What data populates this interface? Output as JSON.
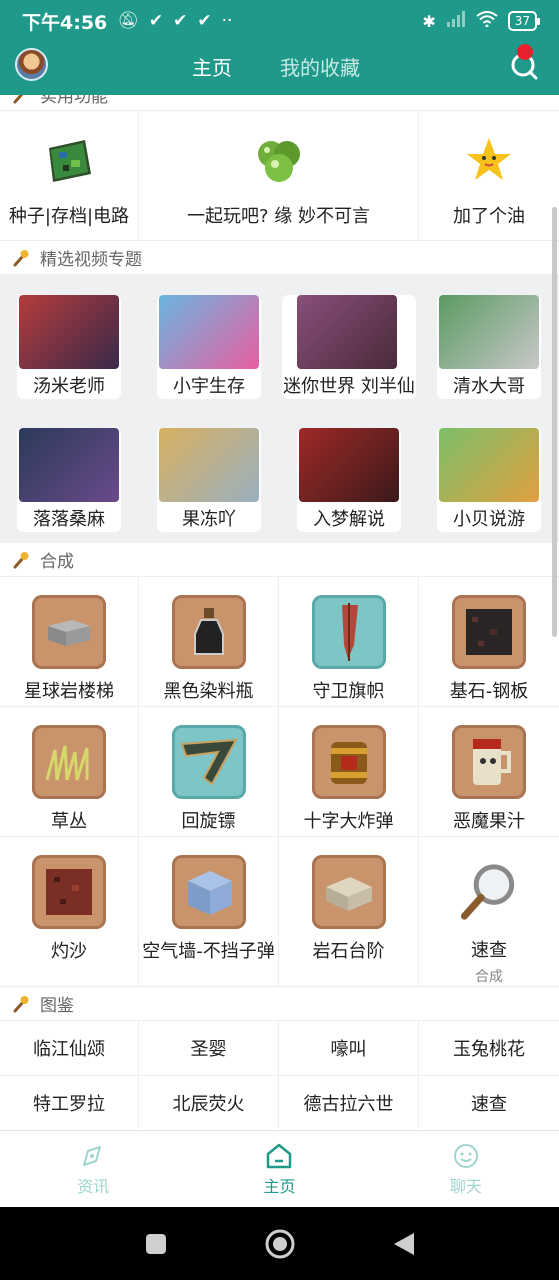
{
  "status": {
    "time": "下午4:56",
    "battery": "37"
  },
  "header": {
    "tabs": [
      {
        "label": "主页"
      },
      {
        "label": "我的收藏"
      }
    ]
  },
  "sections": {
    "utilities": {
      "title": "实用功能",
      "items": [
        {
          "label": "种子|存档|电路",
          "icon": "map-block-icon"
        },
        {
          "label": "一起玩吧? 缘 妙不可言",
          "icon": "green-orbs-icon"
        },
        {
          "label": "加了个油",
          "icon": "star-mascot-icon"
        }
      ]
    },
    "videos": {
      "title": "精选视频专题",
      "items": [
        {
          "label": "汤米老师",
          "color": "#b43b3b"
        },
        {
          "label": "小宇生存",
          "color": "#6ab6e0"
        },
        {
          "label": "迷你世界 刘半仙",
          "color": "#8a4f7a"
        },
        {
          "label": "清水大哥",
          "color": "#5a9a62"
        },
        {
          "label": "落落桑麻",
          "color": "#2b3a5a"
        },
        {
          "label": "果冻吖",
          "color": "#d8b060"
        },
        {
          "label": "入梦解说",
          "color": "#a02828"
        },
        {
          "label": "小贝说游",
          "color": "#7cbf6a"
        }
      ]
    },
    "crafting": {
      "title": "合成",
      "items": [
        {
          "label": "星球岩楼梯",
          "icon": "gray-slab-icon"
        },
        {
          "label": "黑色染料瓶",
          "icon": "dye-bottle-icon"
        },
        {
          "label": "守卫旗帜",
          "icon": "banner-icon"
        },
        {
          "label": "基石-钢板",
          "icon": "bedrock-block-icon"
        },
        {
          "label": "草丛",
          "icon": "grass-icon"
        },
        {
          "label": "回旋镖",
          "icon": "boomerang-icon"
        },
        {
          "label": "十字大炸弹",
          "icon": "barrel-bomb-icon"
        },
        {
          "label": "恶魔果汁",
          "icon": "demon-juice-icon"
        },
        {
          "label": "灼沙",
          "icon": "scorched-sand-icon"
        },
        {
          "label": "空气墙-不挡子弹",
          "icon": "air-wall-icon"
        },
        {
          "label": "岩石台阶",
          "icon": "rock-step-icon"
        },
        {
          "label": "速查",
          "sub": "合成",
          "icon": "magnifier-icon"
        }
      ]
    },
    "catalog": {
      "title": "图鉴",
      "items": [
        {
          "label": "临江仙颂"
        },
        {
          "label": "圣婴"
        },
        {
          "label": "嚎叫"
        },
        {
          "label": "玉兔桃花"
        },
        {
          "label": "特工罗拉"
        },
        {
          "label": "北辰荧火"
        },
        {
          "label": "德古拉六世"
        },
        {
          "label": "速查"
        }
      ]
    }
  },
  "bottom_nav": [
    {
      "label": "资讯",
      "icon": "compass-icon"
    },
    {
      "label": "主页",
      "icon": "home-icon"
    },
    {
      "label": "聊天",
      "icon": "chat-icon"
    }
  ],
  "colors": {
    "brand": "#1f9a8a",
    "inactive_nav": "#9fd5cd"
  }
}
